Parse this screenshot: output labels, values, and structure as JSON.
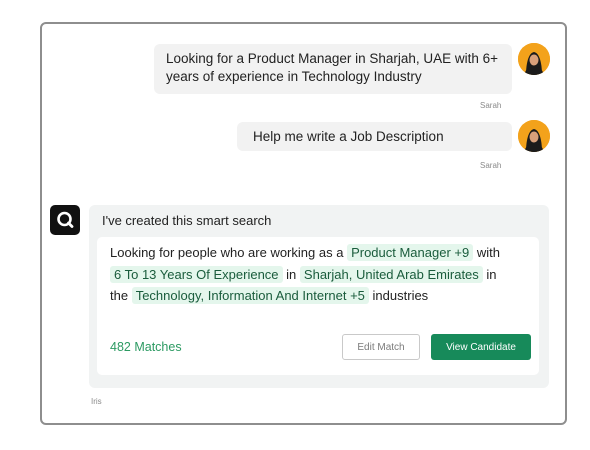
{
  "conversation": {
    "messages": [
      {
        "text": "Looking for a Product Manager in Sharjah, UAE with 6+ years of experience in Technology Industry",
        "sender": "Sarah"
      },
      {
        "text": "Help me write a Job Description",
        "sender": "Sarah"
      }
    ]
  },
  "bot": {
    "name": "Iris",
    "intro": "I've created this smart search",
    "search": {
      "p1": "Looking for people who are working as a",
      "chip_role": "Product Manager +9",
      "p2": "with",
      "chip_exp": "6 To 13 Years Of Experience",
      "p3": "in",
      "chip_loc": "Sharjah, United Arab Emirates",
      "p4": "in",
      "p5": "the",
      "chip_ind": "Technology, Information And Internet +5",
      "p6": "industries"
    },
    "matches": "482 Matches",
    "edit_label": "Edit Match",
    "view_label": "View Candidate"
  },
  "colors": {
    "accent": "#178a5a",
    "chip_bg": "#e4f6ec",
    "avatar_bg": "#f3a21b"
  }
}
